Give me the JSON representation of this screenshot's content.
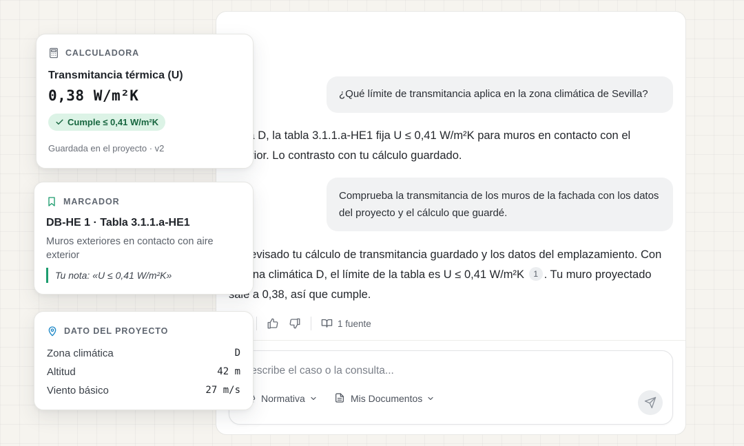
{
  "chat": {
    "q1": "¿Qué límite de transmitancia aplica en la zona climática de Sevilla?",
    "a1_text": "Zona D, la tabla 3.1.1.a-HE1 fija U ≤ 0,41 W/m²K para muros en contacto con el exterior. Lo contrasto con tu cálculo guardado.",
    "q2": "Comprueba la transmitancia de los muros de la fachada con los datos del proyecto y el cálculo que guardé.",
    "a2_part1": "He revisado tu cálculo de transmitancia guardado y los datos del emplazamiento. Con la zona climática D, el límite de la tabla es U ≤ 0,41 W/m²K",
    "a2_citation": "1",
    "a2_part2": ". Tu muro proyectado sale a 0,38, así que cumple.",
    "sources_label": "1 fuente",
    "composer_placeholder": "Describe el caso o la consulta...",
    "pill_normativa": "Normativa",
    "pill_documentos": "Mis Documentos"
  },
  "calculator": {
    "heading": "CALCULADORA",
    "title": "Transmitancia térmica (U)",
    "value": "0,38 W/m²K",
    "badge": "Cumple ≤ 0,41 W/m²K",
    "footer": "Guardada en el proyecto · v2"
  },
  "bookmark": {
    "heading": "MARCADOR",
    "title": "DB-HE 1 · Tabla 3.1.1.a-HE1",
    "description": "Muros exteriores en contacto con aire exterior",
    "note": "Tu nota: «U ≤ 0,41 W/m²K»"
  },
  "project": {
    "heading": "DATO DEL PROYECTO",
    "rows": [
      {
        "label": "Zona climática",
        "value": "D"
      },
      {
        "label": "Altitud",
        "value": "42 m"
      },
      {
        "label": "Viento básico",
        "value": "27 m/s"
      }
    ]
  },
  "colors": {
    "accent_green": "#1c9c6e",
    "badge_bg": "#dcf3e6",
    "location_blue": "#1e88c7"
  },
  "icons": [
    "calculator-icon",
    "bookmark-icon",
    "map-pin-icon",
    "check-icon",
    "thumbs-up-icon",
    "thumbs-down-icon",
    "book-icon",
    "chevron-down-icon",
    "document-icon",
    "send-icon"
  ]
}
